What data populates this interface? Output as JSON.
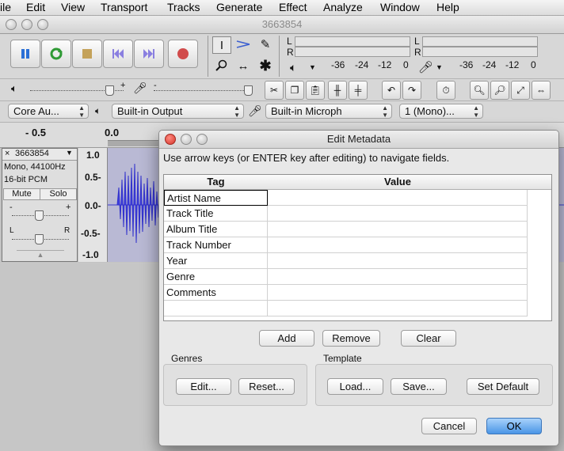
{
  "menubar": {
    "items": [
      "ile",
      "Edit",
      "View",
      "Transport",
      "Tracks",
      "Generate",
      "Effect",
      "Analyze",
      "Window",
      "Help"
    ]
  },
  "window": {
    "title": "3663854"
  },
  "meters": {
    "rec_l": "L",
    "rec_r": "R",
    "play_l": "L",
    "play_r": "R",
    "rec_scale": [
      "-36",
      "-24",
      "-12",
      "0"
    ],
    "play_scale": [
      "-36",
      "-24",
      "-12",
      "0"
    ]
  },
  "devices": {
    "host": "Core Au...",
    "output": "Built-in Output",
    "input": "Built-in Microph",
    "channels": "1 (Mono)..."
  },
  "ruler": {
    "ticks": [
      "- 0.5",
      "0.0"
    ]
  },
  "track": {
    "name": "3663854",
    "format": "Mono, 44100Hz",
    "bits": "16-bit PCM",
    "mute": "Mute",
    "solo": "Solo",
    "pan_l": "L",
    "pan_r": "R",
    "gain_minus": "-",
    "gain_plus": "+",
    "close": "×",
    "axis": [
      "1.0",
      "0.5-",
      "0.0-",
      "-0.5-",
      "-1.0"
    ]
  },
  "dialog": {
    "title": "Edit Metadata",
    "instructions": "Use arrow keys (or ENTER key after editing) to navigate fields.",
    "col_tag": "Tag",
    "col_value": "Value",
    "rows": [
      {
        "tag": "Artist Name",
        "value": ""
      },
      {
        "tag": "Track Title",
        "value": ""
      },
      {
        "tag": "Album Title",
        "value": ""
      },
      {
        "tag": "Track Number",
        "value": ""
      },
      {
        "tag": "Year",
        "value": ""
      },
      {
        "tag": "Genre",
        "value": ""
      },
      {
        "tag": "Comments",
        "value": ""
      },
      {
        "tag": "",
        "value": ""
      }
    ],
    "add": "Add",
    "remove": "Remove",
    "clear": "Clear",
    "genres_label": "Genres",
    "template_label": "Template",
    "edit": "Edit...",
    "reset": "Reset...",
    "load": "Load...",
    "save": "Save...",
    "set_default": "Set Default",
    "cancel": "Cancel",
    "ok": "OK"
  }
}
